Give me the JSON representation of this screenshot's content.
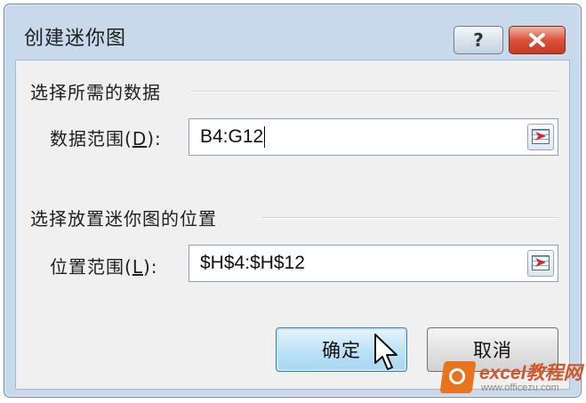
{
  "window": {
    "title": "创建迷你图",
    "help_glyph": "?",
    "close_icon": "close-icon"
  },
  "group_data": {
    "title": "选择所需的数据",
    "field_label_prefix": "数据范围(",
    "field_label_key": "D",
    "field_label_suffix": "):",
    "value": "B4:G12"
  },
  "group_location": {
    "title": "选择放置迷你图的位置",
    "field_label_prefix": "位置范围(",
    "field_label_key": "L",
    "field_label_suffix": "):",
    "value": "$H$4:$H$12"
  },
  "buttons": {
    "ok": "确定",
    "cancel": "取消"
  },
  "watermark": {
    "brand": "excel教程网",
    "url": "www.officezu.com"
  },
  "colors": {
    "ok_button": "#bfe2f6",
    "close_button": "#d9533a",
    "dialog_frame": "#c9d9ec"
  }
}
